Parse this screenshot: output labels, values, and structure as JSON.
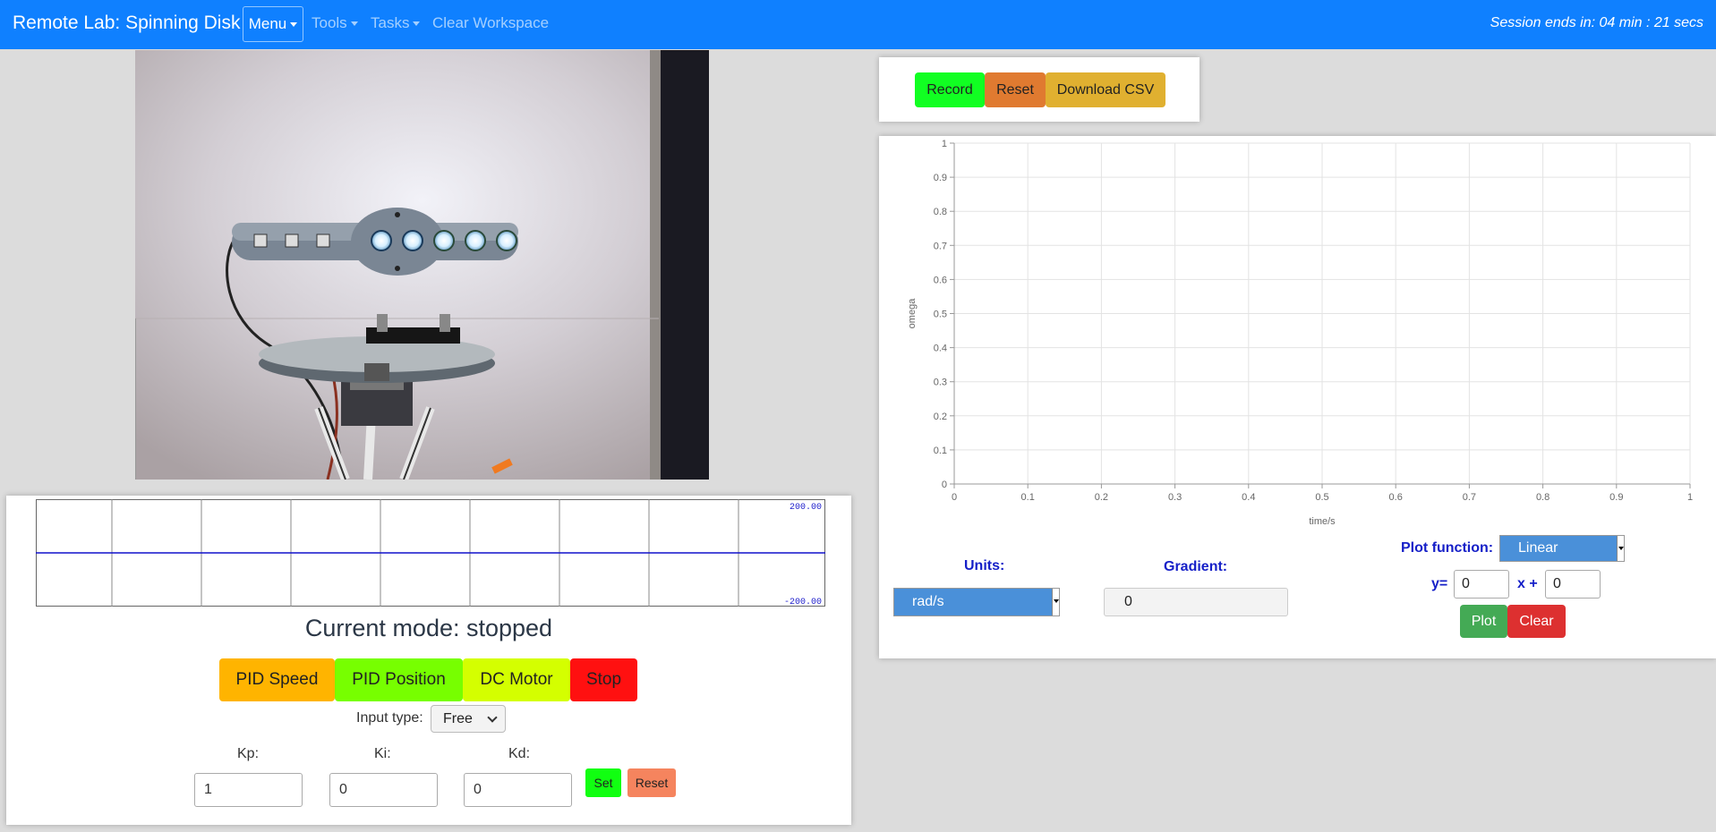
{
  "navbar": {
    "brand": "Remote Lab: Spinning Disk",
    "menu": "Menu",
    "tools": "Tools",
    "tasks": "Tasks",
    "clear_workspace": "Clear Workspace",
    "session": "Session ends in: 04 min : 21 secs"
  },
  "scope": {
    "max_label": "200.00",
    "min_label": "-200.00",
    "trace_value": 0,
    "range": [
      -200,
      200
    ]
  },
  "mode": {
    "text": "Current mode: stopped"
  },
  "mode_buttons": {
    "pid_speed": "PID Speed",
    "pid_position": "PID Position",
    "dc_motor": "DC Motor",
    "stop": "Stop"
  },
  "input_type": {
    "label": "Input type:",
    "value": "Free"
  },
  "pid": {
    "kp_label": "Kp:",
    "ki_label": "Ki:",
    "kd_label": "Kd:",
    "kp": "1",
    "ki": "0",
    "kd": "0",
    "set": "Set",
    "reset": "Reset"
  },
  "record": {
    "record": "Record",
    "reset": "Reset",
    "download": "Download CSV"
  },
  "chart_data": {
    "type": "line",
    "xlabel": "time/s",
    "ylabel": "omega",
    "xlim": [
      0,
      1
    ],
    "ylim": [
      0,
      1
    ],
    "xticks": [
      "0",
      "0.1",
      "0.2",
      "0.3",
      "0.4",
      "0.5",
      "0.6",
      "0.7",
      "0.8",
      "0.9",
      "1"
    ],
    "yticks": [
      "0",
      "0.1",
      "0.2",
      "0.3",
      "0.4",
      "0.5",
      "0.6",
      "0.7",
      "0.8",
      "0.9",
      "1"
    ],
    "grid": true,
    "series": []
  },
  "controls": {
    "units_label": "Units:",
    "units_value": "rad/s",
    "gradient_label": "Gradient:",
    "gradient_value": "0",
    "plot_function_label": "Plot function:",
    "plot_function_value": "Linear",
    "y_eq": "y=",
    "x_plus": "x +",
    "m_value": "0",
    "c_value": "0",
    "plot": "Plot",
    "clear": "Clear"
  },
  "colors": {
    "navbar": "#0f80ff",
    "pid_speed": "#ffb400",
    "pid_position": "#77ff00",
    "dc_motor": "#d4ff00",
    "stop": "#ff1010",
    "set": "#11ff11",
    "reset_small": "#f5845e",
    "record": "#11ff22",
    "reset": "#e07a30",
    "download": "#e0b030",
    "plot": "#44aa55",
    "clear": "#dd3030",
    "scope_trace": "#1010cc"
  }
}
